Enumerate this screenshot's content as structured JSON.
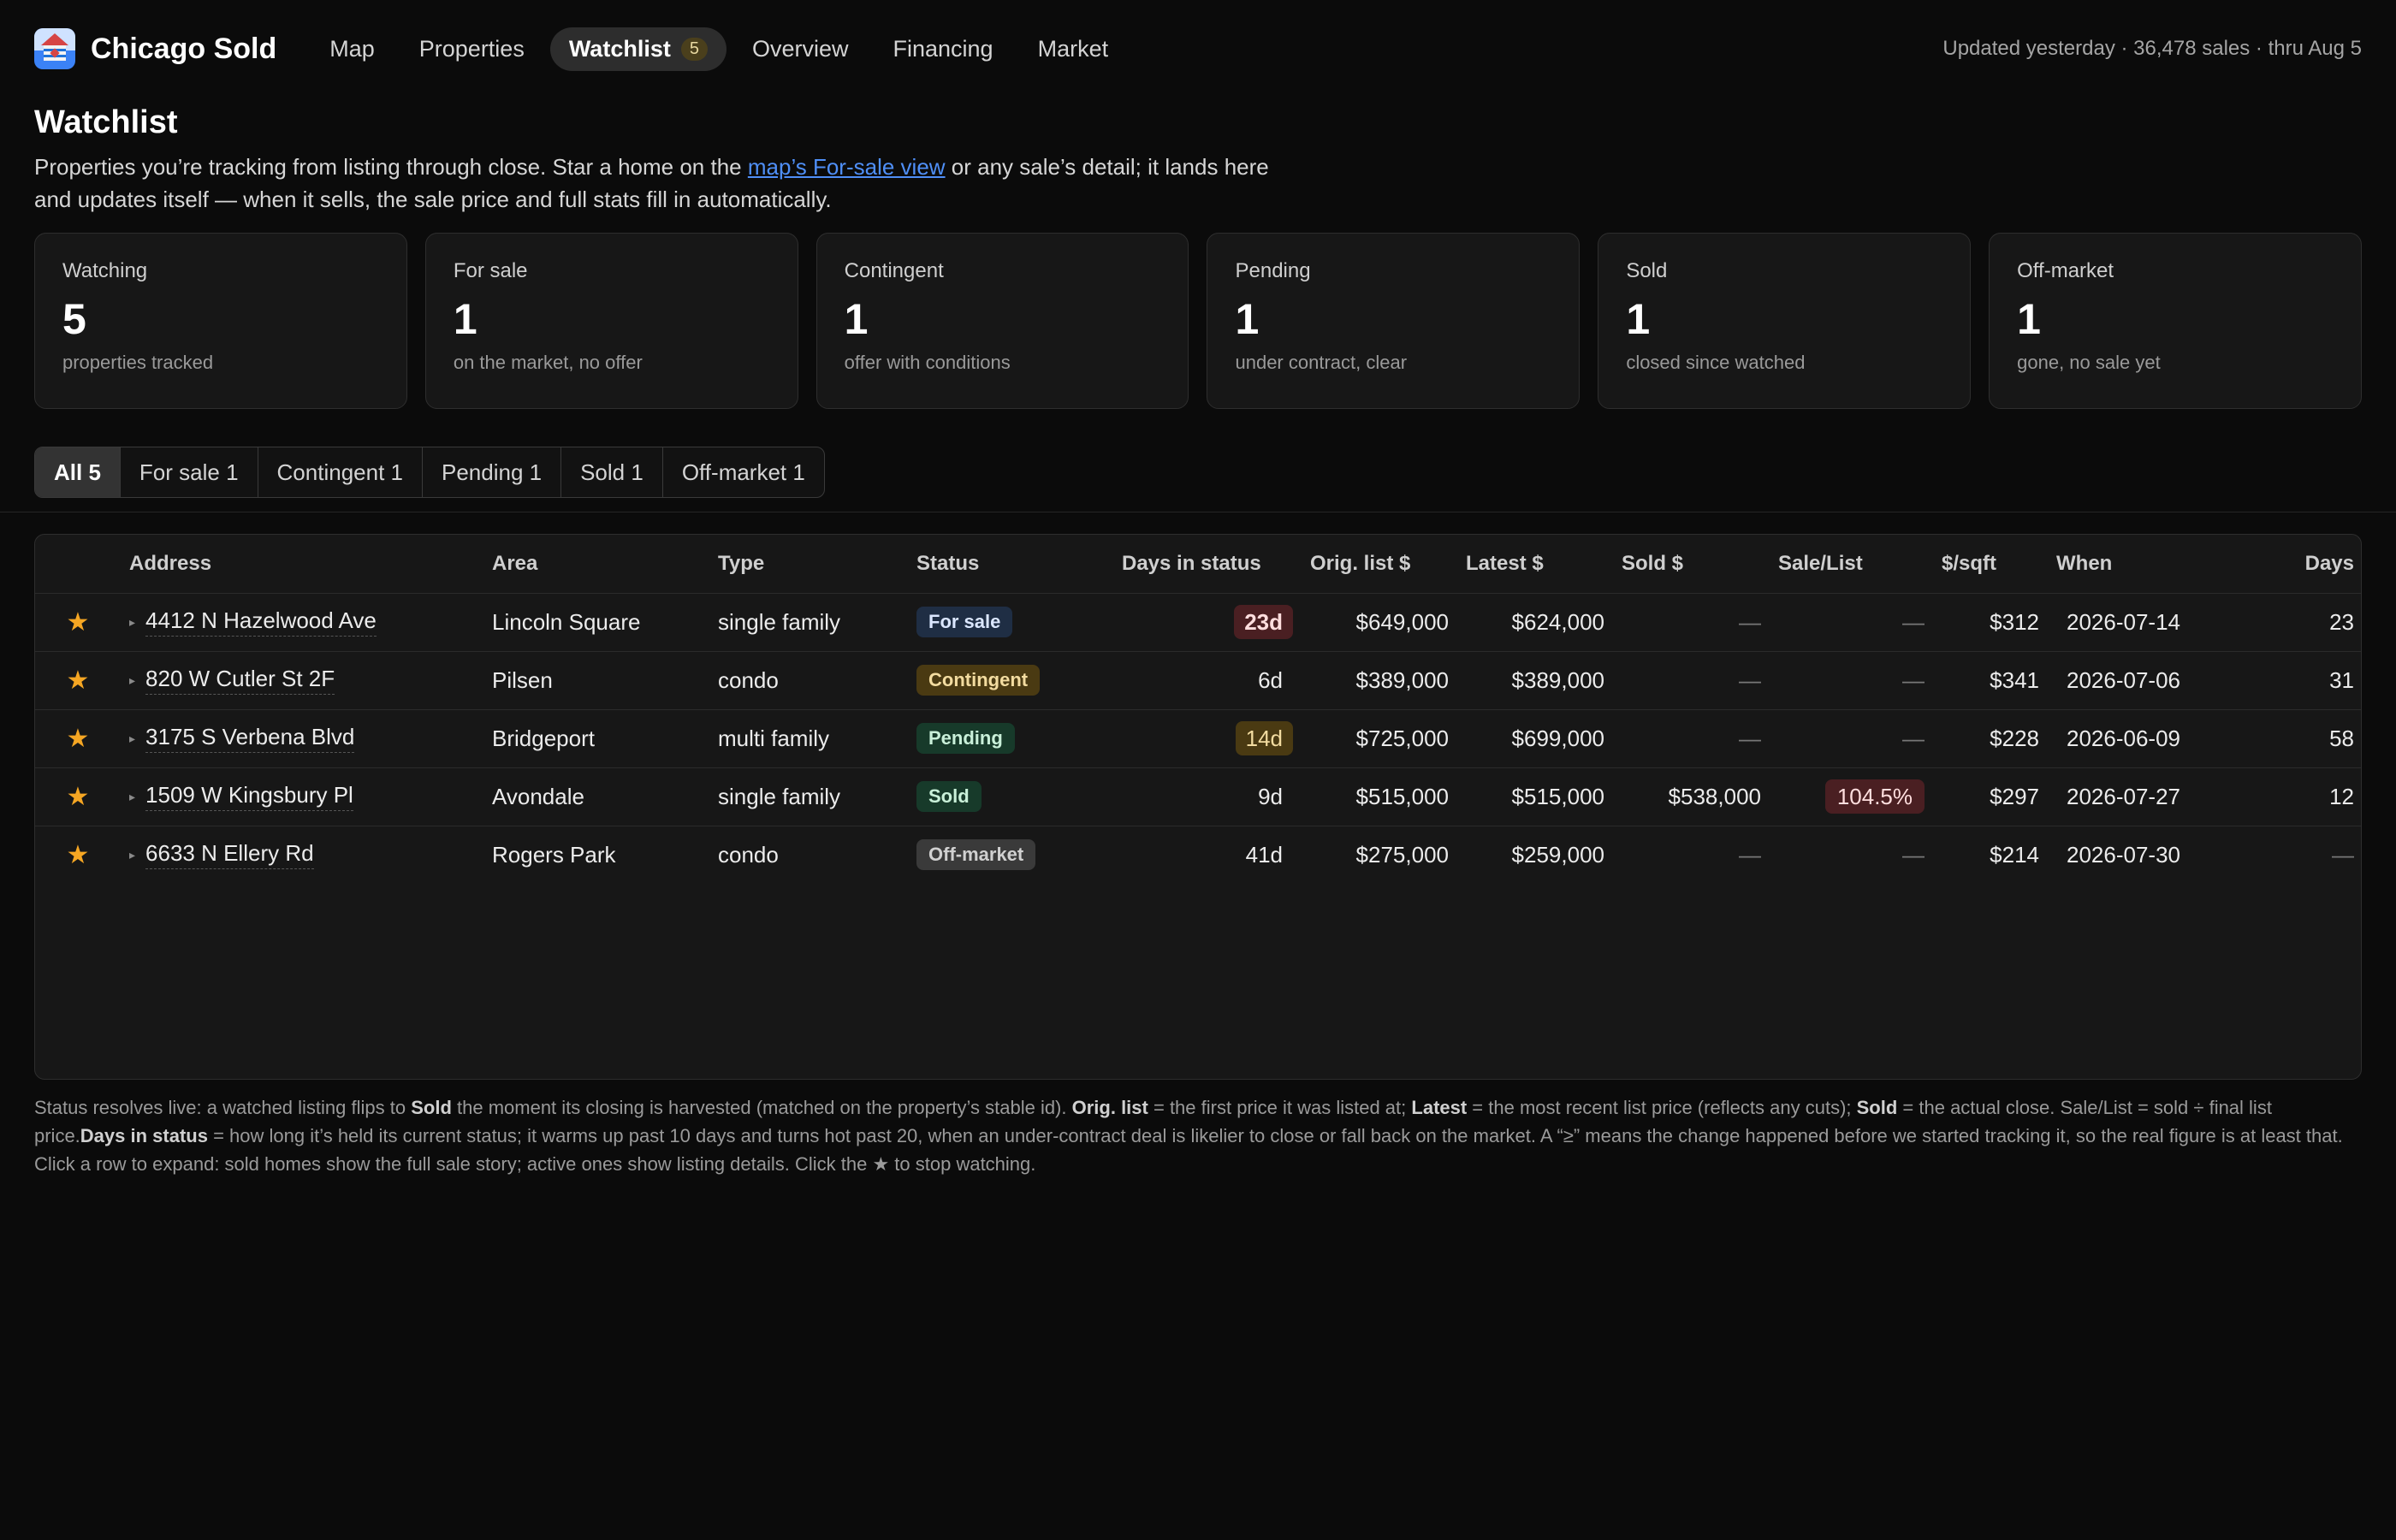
{
  "app": {
    "name": "Chicago Sold",
    "updated": "Updated yesterday · 36,478 sales · thru Aug 5"
  },
  "nav": {
    "items": [
      {
        "label": "Map"
      },
      {
        "label": "Properties"
      },
      {
        "label": "Watchlist",
        "badge": "5",
        "active": true
      },
      {
        "label": "Overview"
      },
      {
        "label": "Financing"
      },
      {
        "label": "Market"
      }
    ]
  },
  "page": {
    "title": "Watchlist",
    "intro_before": "Properties you’re tracking from listing through close. Star a home on the ",
    "intro_link": "map’s For-sale view",
    "intro_after": " or any sale’s detail; it lands here and updates itself — when it sells, the sale price and full stats fill in automatically."
  },
  "cards": [
    {
      "label": "Watching",
      "value": "5",
      "sub": "properties tracked"
    },
    {
      "label": "For sale",
      "value": "1",
      "sub": "on the market, no offer"
    },
    {
      "label": "Contingent",
      "value": "1",
      "sub": "offer with conditions"
    },
    {
      "label": "Pending",
      "value": "1",
      "sub": "under contract, clear"
    },
    {
      "label": "Sold",
      "value": "1",
      "sub": "closed since watched"
    },
    {
      "label": "Off-market",
      "value": "1",
      "sub": "gone, no sale yet"
    }
  ],
  "filters": [
    {
      "label": "All 5",
      "active": true
    },
    {
      "label": "For sale 1"
    },
    {
      "label": "Contingent 1"
    },
    {
      "label": "Pending 1"
    },
    {
      "label": "Sold 1"
    },
    {
      "label": "Off-market 1"
    }
  ],
  "table": {
    "columns": [
      "",
      "Address",
      "Area",
      "Type",
      "Status",
      "Days in status",
      "Orig. list $",
      "Latest $",
      "Sold $",
      "Sale/List",
      "$/sqft",
      "When",
      "Days"
    ],
    "rows": [
      {
        "star": "★",
        "caret": "▸",
        "address": "4412 N Hazelwood Ave",
        "area": "Lincoln Square",
        "type": "single family",
        "status": "For sale",
        "days_in_status": "23d",
        "orig_list": "$649,000",
        "latest": "$624,000",
        "sold": "—",
        "sale_list": "—",
        "per_sqft": "$312",
        "when": "2026-07-14",
        "days": "23"
      },
      {
        "star": "★",
        "caret": "▸",
        "address": "820 W Cutler St 2F",
        "area": "Pilsen",
        "type": "condo",
        "status": "Contingent",
        "days_in_status": "6d",
        "orig_list": "$389,000",
        "latest": "$389,000",
        "sold": "—",
        "sale_list": "—",
        "per_sqft": "$341",
        "when": "2026-07-06",
        "days": "31"
      },
      {
        "star": "★",
        "caret": "▸",
        "address": "3175 S Verbena Blvd",
        "area": "Bridgeport",
        "type": "multi family",
        "status": "Pending",
        "days_in_status": "14d",
        "orig_list": "$725,000",
        "latest": "$699,000",
        "sold": "—",
        "sale_list": "—",
        "per_sqft": "$228",
        "when": "2026-06-09",
        "days": "58"
      },
      {
        "star": "★",
        "caret": "▸",
        "address": "1509 W Kingsbury Pl",
        "area": "Avondale",
        "type": "single family",
        "status": "Sold",
        "days_in_status": "9d",
        "orig_list": "$515,000",
        "latest": "$515,000",
        "sold": "$538,000",
        "sale_list": "104.5%",
        "per_sqft": "$297",
        "when": "2026-07-27",
        "days": "12"
      },
      {
        "star": "★",
        "caret": "▸",
        "address": "6633 N Ellery Rd",
        "area": "Rogers Park",
        "type": "condo",
        "status": "Off-market",
        "days_in_status": "41d",
        "orig_list": "$275,000",
        "latest": "$259,000",
        "sold": "—",
        "sale_list": "—",
        "per_sqft": "$214",
        "when": "2026-07-30",
        "days": "—"
      }
    ]
  },
  "footnote": {
    "p1": "Status resolves live: a watched listing flips to ",
    "b1": "Sold",
    "p2": " the moment its closing is harvested (matched on the property’s stable id). ",
    "b2": "Orig. list",
    "p3": " = the first price it was listed at; ",
    "b3": "Latest",
    "p4": " = the most recent list price (reflects any cuts); ",
    "b4": "Sold",
    "p5": " = the actual close. Sale/List = sold ÷ final list price.",
    "b5": "Days in status",
    "p6": " = how long it’s held its current status; it warms up past 10 days and turns hot past 20, when an under-contract deal is likelier to close or fall back on the market. A “≥” means the change happened before we started tracking it, so the real figure is at least that. Click a row to expand: sold homes show the full sale story; active ones show listing details. Click the ★ to stop watching."
  },
  "colors": {
    "accent_star": "#f5a623",
    "link": "#4f8ff7",
    "background": "#0b0b0b",
    "panel": "#171717"
  }
}
